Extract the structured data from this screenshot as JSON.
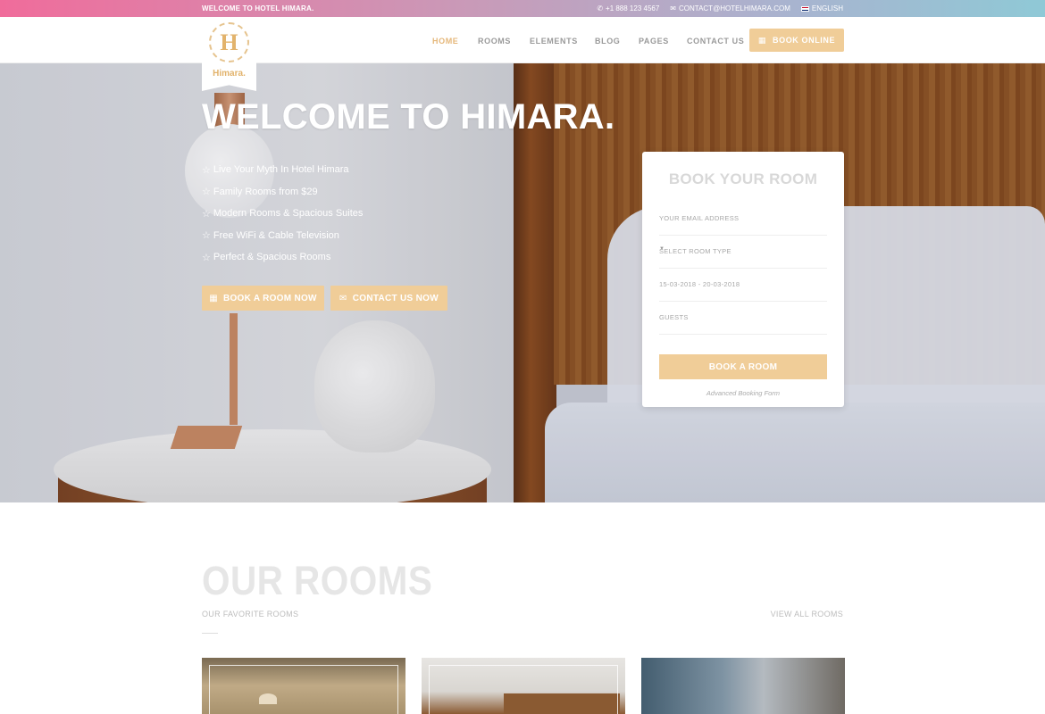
{
  "topbar": {
    "welcome": "WELCOME TO HOTEL HIMARA.",
    "phone": "+1 888 123 4567",
    "email": "CONTACT@HOTELHIMARA.COM",
    "language": "ENGLISH"
  },
  "logo": {
    "letter": "H",
    "name": "Himara."
  },
  "nav": {
    "items": [
      {
        "label": "HOME",
        "active": true
      },
      {
        "label": "ROOMS"
      },
      {
        "label": "ELEMENTS"
      },
      {
        "label": "BLOG"
      },
      {
        "label": "PAGES"
      },
      {
        "label": "CONTACT US"
      }
    ],
    "cta": "BOOK ONLINE"
  },
  "hero": {
    "title": "WELCOME TO HIMARA.",
    "features": [
      "Live Your Myth In Hotel Himara",
      "Family Rooms from $29",
      "Modern Rooms & Spacious Suites",
      "Free WiFi & Cable Television",
      "Perfect & Spacious Rooms"
    ],
    "book_button": "BOOK A ROOM NOW",
    "contact_button": "CONTACT US NOW"
  },
  "booking": {
    "title": "BOOK YOUR ROOM",
    "email_placeholder": "YOUR EMAIL ADDRESS",
    "room_type": "SELECT ROOM TYPE",
    "dates": "15-03-2018 - 20-03-2018",
    "guests": "GUESTS",
    "submit": "BOOK A ROOM",
    "advanced": "Advanced Booking Form"
  },
  "rooms": {
    "title": "OUR ROOMS",
    "subtitle": "OUR FAVORITE ROOMS",
    "view_all": "VIEW ALL ROOMS"
  },
  "colors": {
    "accent": "#f0cd98",
    "active_nav": "#e5b77a",
    "topbar_start": "#f06c9b",
    "topbar_end": "#8fc9d6"
  }
}
